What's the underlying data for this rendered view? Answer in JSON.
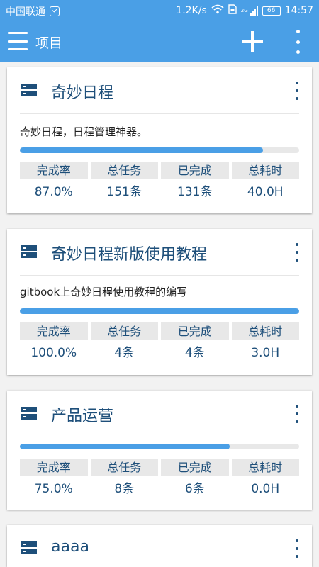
{
  "status_bar": {
    "carrier": "中国联通",
    "speed": "1.2K/s",
    "network_tag": "2G",
    "battery": "66",
    "time": "14:57"
  },
  "app_bar": {
    "title": "项目",
    "icons": [
      "menu-icon",
      "add-icon",
      "more-vert-icon"
    ]
  },
  "stat_headers": [
    "完成率",
    "总任务",
    "已完成",
    "总耗时"
  ],
  "projects": [
    {
      "name": "奇妙日程",
      "description": "奇妙日程，日程管理神器。",
      "progress": 0.87,
      "completion_rate": "87.0%",
      "total_tasks": "151条",
      "completed": "131条",
      "total_time": "40.0H"
    },
    {
      "name": "奇妙日程新版使用教程",
      "description": "gitbook上奇妙日程使用教程的编写",
      "progress": 1.0,
      "completion_rate": "100.0%",
      "total_tasks": "4条",
      "completed": "4条",
      "total_time": "3.0H"
    },
    {
      "name": "产品运营",
      "description": "",
      "progress": 0.75,
      "completion_rate": "75.0%",
      "total_tasks": "8条",
      "completed": "6条",
      "total_time": "0.0H"
    },
    {
      "name": "aaaa"
    }
  ],
  "colors": {
    "primary": "#4a9fe6",
    "dark_blue": "#1e4f7a",
    "track": "#e8e8e8"
  }
}
